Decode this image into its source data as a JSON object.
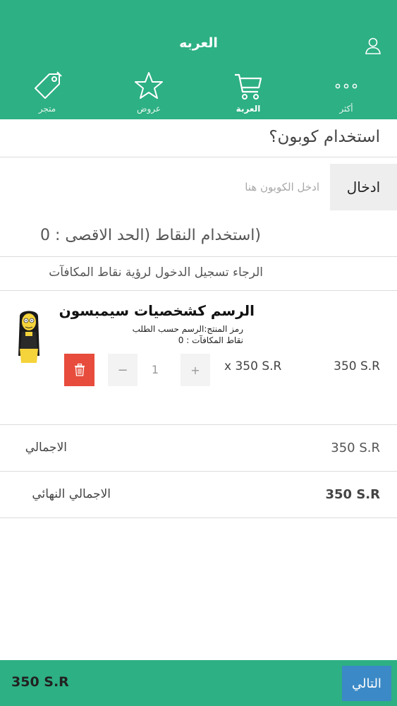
{
  "header": {
    "title": "العربه"
  },
  "tabs": [
    {
      "label": "متجر",
      "icon": "tag-icon"
    },
    {
      "label": "عروض",
      "icon": "star-icon"
    },
    {
      "label": "العربة",
      "icon": "cart-icon"
    },
    {
      "label": "أكثر",
      "icon": "more-icon"
    }
  ],
  "coupon": {
    "title": "استخدام كوبون؟",
    "placeholder": "ادخل الكوبون هنا",
    "enter_label": "ادخال"
  },
  "points": {
    "label": "(استخدام النقاط (الحد الاقصى : 0",
    "login_prompt": "الرجاء تسجيل الدخول لرؤية نقاط المكافآت"
  },
  "cart_item": {
    "name": "الرسم كشخصيات سيمبسون",
    "code": "رمز المنتج:الرسم حسب الطلب",
    "reward_points": "نقاط المكافآت : 0",
    "quantity": "1",
    "minus": "−",
    "plus": "+",
    "unit_price": "x 350 S.R",
    "line_total": "350 S.R"
  },
  "totals": {
    "subtotal_label": "الاجمالي",
    "subtotal_value": "350 S.R",
    "final_label": "الاجمالي النهائي",
    "final_value": "350 S.R"
  },
  "footer": {
    "total": "350 S.R",
    "next_label": "التالي"
  },
  "colors": {
    "brand": "#2db083",
    "delete": "#e74c3c",
    "next": "#3b89c6"
  }
}
